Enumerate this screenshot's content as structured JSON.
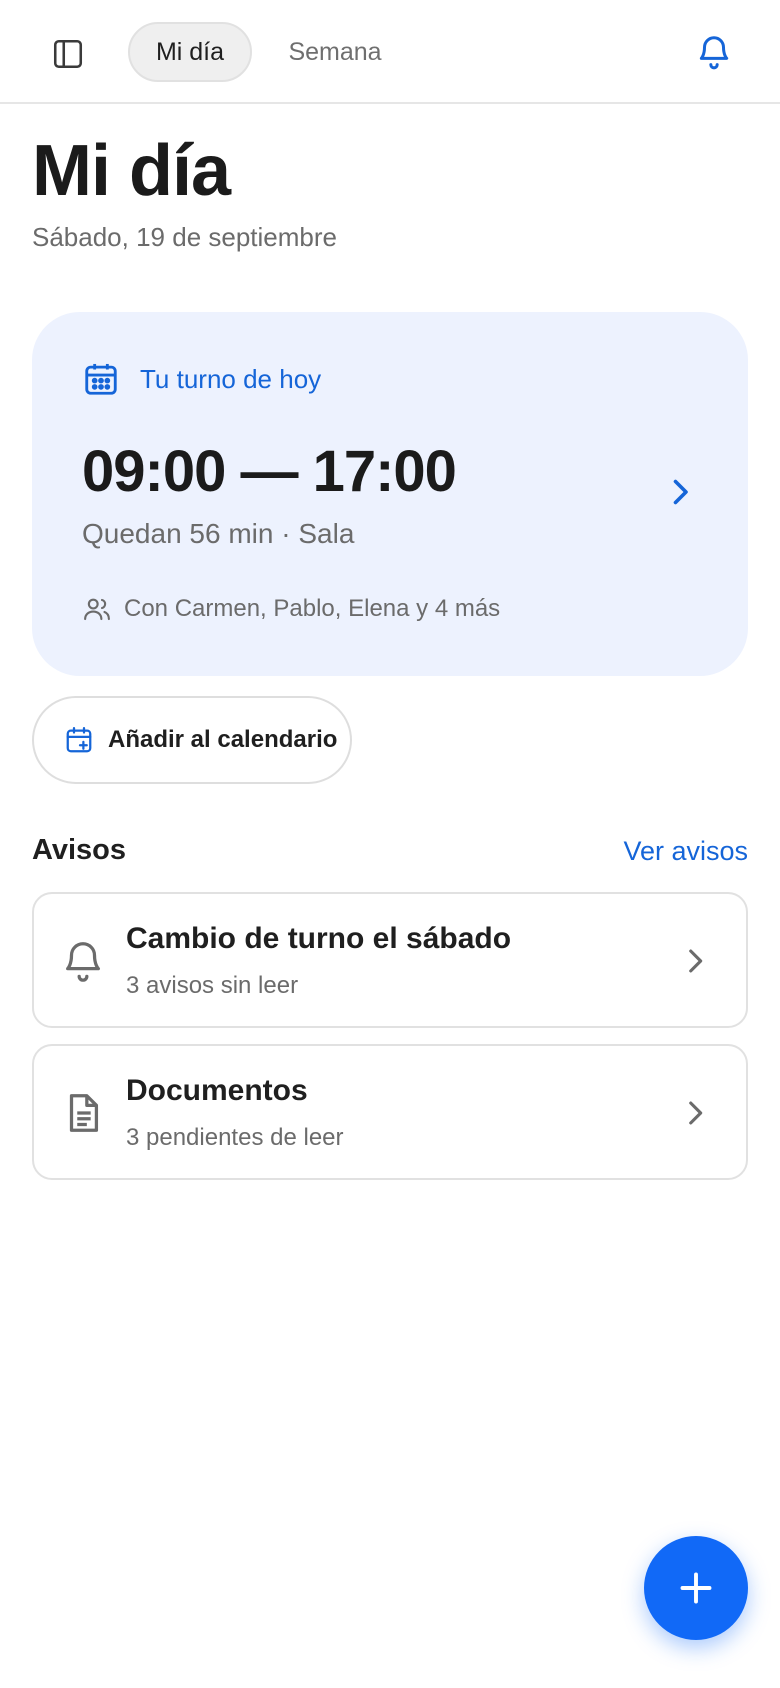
{
  "header": {
    "tabs": [
      {
        "label": "Mi día",
        "active": true
      },
      {
        "label": "Semana",
        "active": false
      }
    ]
  },
  "page": {
    "title": "Mi día",
    "date": "Sábado, 19 de septiembre"
  },
  "shift": {
    "label": "Tu turno de hoy",
    "time": "09:00 — 17:00",
    "remaining": "Quedan 56 min · Sala",
    "people": "Con Carmen, Pablo, Elena y 4 más"
  },
  "actions": {
    "add_calendar_label": "Añadir al calendario"
  },
  "notices": {
    "title": "Avisos",
    "link": "Ver avisos",
    "items": [
      {
        "title": "Cambio de turno el sábado",
        "subtitle": "3 avisos sin leer",
        "icon": "bell-icon"
      },
      {
        "title": "Documentos",
        "subtitle": "3 pendientes de leer",
        "icon": "document-icon"
      }
    ]
  },
  "colors": {
    "accent": "#1565d8",
    "fab": "#1169f7",
    "card_bg": "#edf2fe"
  }
}
